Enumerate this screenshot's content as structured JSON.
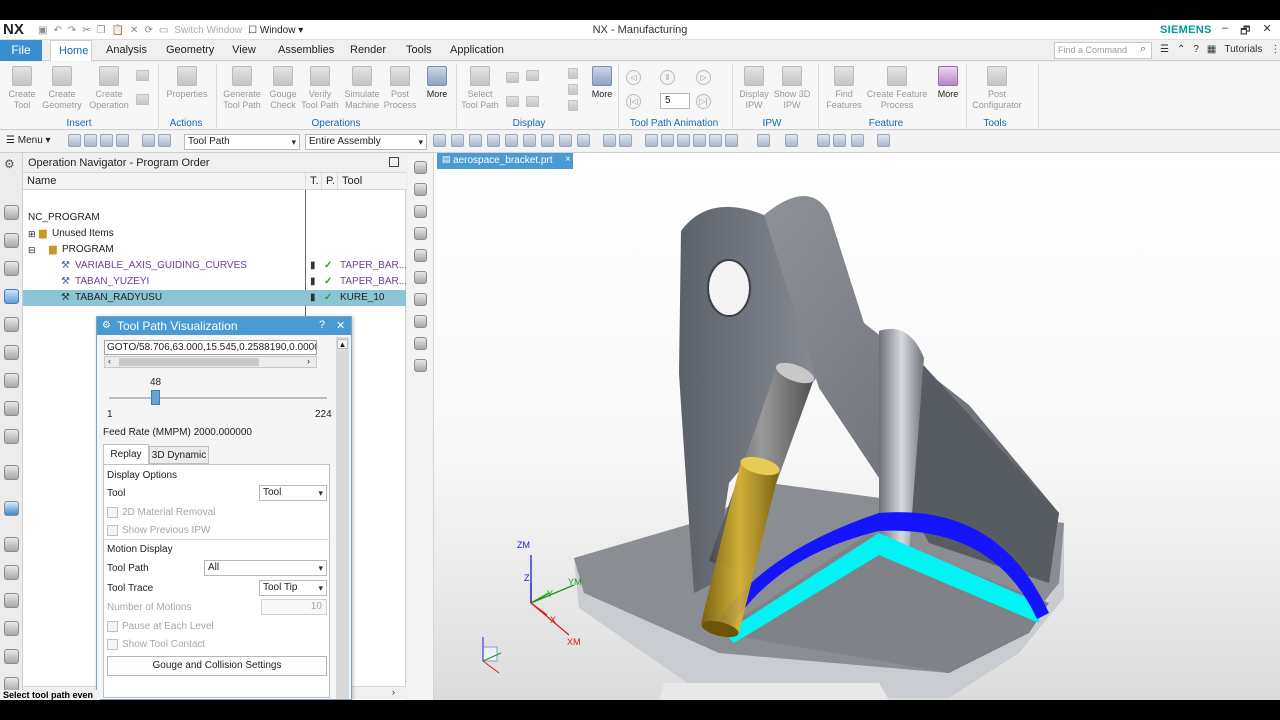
{
  "app": {
    "logo": "NX",
    "window_title": "NX - Manufacturing",
    "brand": "SIEMENS",
    "qat_switch_window": "Switch Window",
    "qat_window": "Window",
    "window_controls": [
      "–",
      "🗗",
      "✕"
    ]
  },
  "menu_tabs": [
    "File",
    "Home",
    "Analysis",
    "Geometry",
    "View",
    "Assemblies",
    "Render",
    "Tools",
    "Application"
  ],
  "active_tab": "Home",
  "find_command": {
    "placeholder": "Find a Command"
  },
  "tutorials_label": "Tutorials",
  "ribbon": {
    "buttons": [
      {
        "label": "Create\nTool"
      },
      {
        "label": "Create\nGeometry"
      },
      {
        "label": "Create\nOperation"
      },
      {
        "label": "Properties"
      },
      {
        "label": "Generate\nTool Path"
      },
      {
        "label": "Gouge\nCheck"
      },
      {
        "label": "Verify\nTool Path"
      },
      {
        "label": "Simulate\nMachine"
      },
      {
        "label": "Post\nProcess"
      },
      {
        "label": "More"
      },
      {
        "label": "Select\nTool Path"
      },
      {
        "label": "More"
      },
      {
        "label": "Display\nIPW"
      },
      {
        "label": "Show 3D\nIPW"
      },
      {
        "label": "Find\nFeatures"
      },
      {
        "label": "Create Feature\nProcess"
      },
      {
        "label": "More"
      },
      {
        "label": "Post\nConfigurator"
      }
    ],
    "groups": [
      "Insert",
      "Actions",
      "Operations",
      "Display",
      "Tool Path Animation",
      "IPW",
      "Feature",
      "Tools"
    ],
    "animation_speed": "5"
  },
  "toolbar2": {
    "menu_label": "Menu",
    "filter_select": "Tool Path",
    "scope_select": "Entire Assembly"
  },
  "op_nav": {
    "title": "Operation Navigator - Program Order",
    "columns": [
      "Name",
      "T.",
      "P.",
      "Tool"
    ],
    "rows": [
      {
        "name": "NC_PROGRAM",
        "tool": ""
      },
      {
        "name": "Unused Items",
        "tool": ""
      },
      {
        "name": "PROGRAM",
        "tool": ""
      },
      {
        "name": "VARIABLE_AXIS_GUIDING_CURVES",
        "tool": "TAPER_BAR..."
      },
      {
        "name": "TABAN_YUZEYI",
        "tool": "TAPER_BAR..."
      },
      {
        "name": "TABAN_RADYUSU",
        "tool": "KURE_10"
      }
    ],
    "check": "✓"
  },
  "tpv_dialog": {
    "title": "Tool Path Visualization",
    "help": "?",
    "close": "✕",
    "goto_text": "GOTO/58.706,63.000,15.545,0.2588190,0.0000000",
    "slider_value": "48",
    "slider_min": "1",
    "slider_max": "224",
    "slider_fraction": 0.2108,
    "feed_rate": "Feed Rate (MMPM) 2000.000000",
    "tabs": [
      "Replay",
      "3D Dynamic"
    ],
    "active_tab": "Replay",
    "display_options": "Display Options",
    "tool_label": "Tool",
    "tool_value": "Tool",
    "cb_2d": "2D Material Removal",
    "cb_prev": "Show Previous IPW",
    "motion_display": "Motion Display",
    "tool_path_label": "Tool Path",
    "tool_path_value": "All",
    "tool_trace_label": "Tool Trace",
    "tool_trace_value": "Tool Tip",
    "num_motions_label": "Number of Motions",
    "num_motions_value": "10",
    "cb_pause": "Pause at Each Level",
    "cb_contact": "Show Tool Contact",
    "gouge_button": "Gouge and Collision Settings"
  },
  "graphics": {
    "doc_tab": "aerospace_bracket.prt",
    "axis_labels": [
      "ZM",
      "Z",
      "Y",
      "YM",
      "X",
      "XM"
    ],
    "colors": {
      "part": "#7c8088",
      "toolpath": "#1414ff",
      "floor_pass": "#00f4f4",
      "tool": "#c9a21d",
      "holder": "#6e6e6e"
    }
  },
  "status": {
    "text": "Select tool path even"
  }
}
